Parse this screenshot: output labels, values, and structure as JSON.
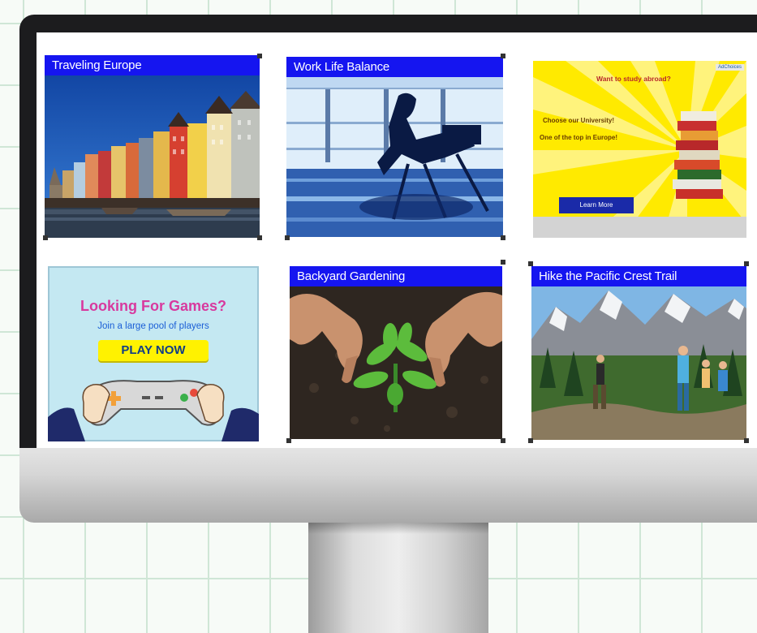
{
  "tiles": {
    "europe": {
      "title": "Traveling Europe"
    },
    "worklife": {
      "title": "Work Life Balance"
    },
    "gardening": {
      "title": "Backyard Gardening"
    },
    "hike": {
      "title": "Hike the Pacific Crest Trail"
    }
  },
  "ads": {
    "study": {
      "choices": "AdChoices",
      "headline": "Want to study abroad?",
      "line1": "Choose our University!",
      "line2": "One of  the  top in Europe!",
      "button": "Learn More"
    },
    "games": {
      "title": "Looking For Games?",
      "subtitle": "Join a large pool of players",
      "button": "PLAY NOW"
    }
  },
  "colors": {
    "title_bar": "#1515f0",
    "grid_line": "#cfe6d6",
    "bezel": "#1c1c1e"
  }
}
